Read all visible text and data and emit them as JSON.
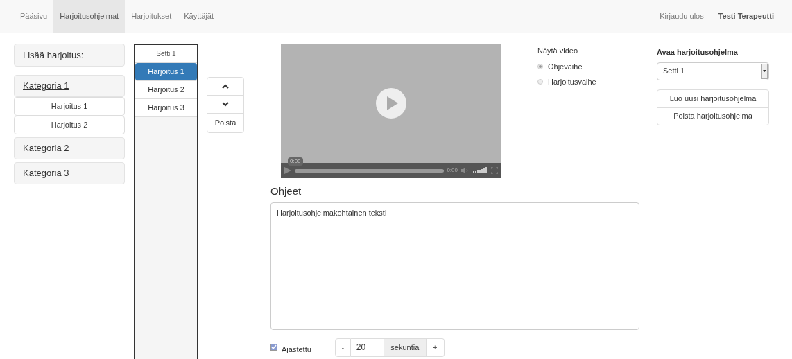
{
  "navbar": {
    "tabs": [
      {
        "label": "Pääsivu",
        "selected": false
      },
      {
        "label": "Harjoitusohjelmat",
        "selected": true
      },
      {
        "label": "Harjoitukset",
        "selected": false
      },
      {
        "label": "Käyttäjät",
        "selected": false
      }
    ],
    "logout": "Kirjaudu ulos",
    "user": "Testi Terapeutti"
  },
  "add_panel": {
    "title": "Lisää harjoitus:",
    "categories": [
      {
        "label": "Kategoria 1",
        "expanded": true,
        "children": [
          {
            "label": "Harjoitus 1"
          },
          {
            "label": "Harjoitus 2"
          }
        ]
      },
      {
        "label": "Kategoria 2",
        "expanded": false
      },
      {
        "label": "Kategoria 3",
        "expanded": false
      }
    ]
  },
  "program_list": {
    "items": [
      {
        "label": "Setti 1",
        "kind": "header",
        "selected": false
      },
      {
        "label": "Harjoitus 1",
        "kind": "item",
        "selected": true
      },
      {
        "label": "Harjoitus 2",
        "kind": "item",
        "selected": false
      },
      {
        "label": "Harjoitus 3",
        "kind": "item",
        "selected": false
      }
    ]
  },
  "order_buttons": {
    "remove": "Poista"
  },
  "video": {
    "bubble_time": "0:00",
    "time": "0:00"
  },
  "show_video": {
    "title": "Näytä video",
    "options": [
      {
        "label": "Ohjevaihe",
        "selected": true
      },
      {
        "label": "Harjoitusvaihe",
        "selected": false
      }
    ]
  },
  "instructions": {
    "title": "Ohjeet",
    "value": "Harjoitusohjelmakohtainen teksti"
  },
  "timer": {
    "label": "Ajastettu",
    "checked": true,
    "minus": "-",
    "value": "20",
    "unit": "sekuntia",
    "plus": "+"
  },
  "open_program": {
    "title": "Avaa harjoitusohjelma",
    "select_value": "Setti 1",
    "buttons": [
      "Luo uusi harjoitusohjelma",
      "Poista harjoitusohjelma"
    ]
  }
}
